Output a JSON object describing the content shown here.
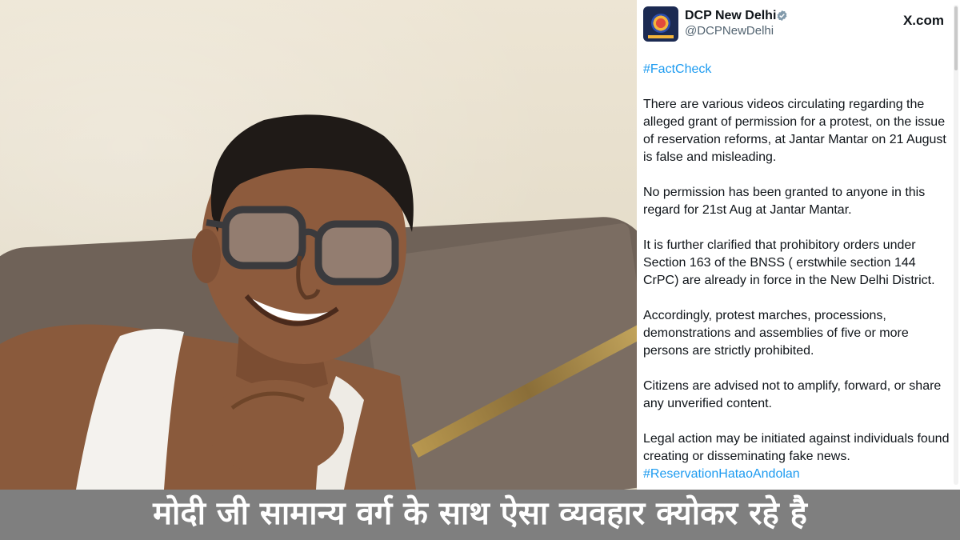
{
  "tweet": {
    "author_name": "DCP New Delhi",
    "author_handle": "@DCPNewDelhi",
    "source": "X.com",
    "verified_icon": "verified-badge-icon",
    "paragraphs": [
      "#FactCheck",
      "There are various videos circulating regarding the alleged grant of permission for a protest, on the issue of reservation reforms, at Jantar Mantar on 21 August is false and misleading.",
      "No permission has been granted to anyone in this regard for 21st Aug at Jantar Mantar.",
      "It is further clarified that prohibitory orders under Section 163 of the BNSS ( erstwhile section 144 CrPC) are already in force in the New Delhi District.",
      "Accordingly, protest marches, processions, demonstrations and assemblies of five or more persons are strictly prohibited.",
      "Citizens are advised not to amplify, forward, or share any unverified content.",
      "Legal action may be initiated against individuals found creating or disseminating fake news."
    ],
    "trailing_hashtag": "#ReservationHataoAndolan"
  },
  "caption": {
    "text": "मोदी जी सामान्य वर्ग के साथ ऐसा व्यवहार क्योकर रहे है"
  },
  "colors": {
    "link": "#1d9bf0",
    "caption_band": "#7f7f7f",
    "card_bg": "#ffffff"
  }
}
